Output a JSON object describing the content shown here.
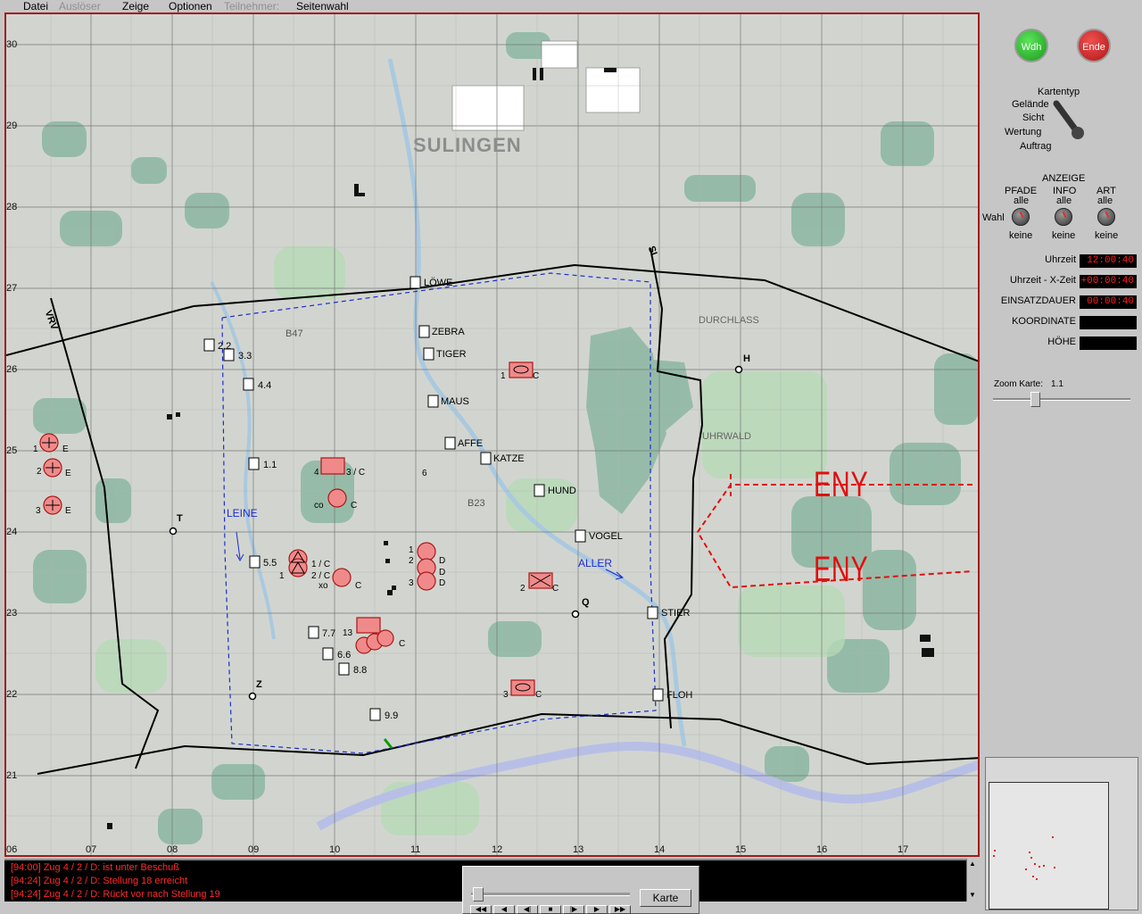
{
  "menu": {
    "items": [
      {
        "label": "Datei",
        "enabled": true
      },
      {
        "label": "Auslöser",
        "enabled": false
      },
      {
        "label": "Zeige",
        "enabled": true
      },
      {
        "label": "Optionen",
        "enabled": true
      },
      {
        "label": "Teilnehmer:",
        "enabled": false
      },
      {
        "label": "Seitenwahl",
        "enabled": true
      }
    ]
  },
  "map": {
    "grid_x_labels": [
      "06",
      "07",
      "08",
      "09",
      "10",
      "11",
      "12",
      "13",
      "14",
      "15",
      "16",
      "17"
    ],
    "grid_y_labels": [
      "30",
      "29",
      "28",
      "27",
      "26",
      "25",
      "24",
      "23",
      "22",
      "21"
    ],
    "city": "SULINGEN",
    "regions": [
      "DURCHLASS",
      "UHRWALD"
    ],
    "roads": [
      "B47",
      "B23"
    ],
    "rivers": [
      "LEINE",
      "ALLER"
    ],
    "boundary_labels": [
      "VRV",
      "SL"
    ],
    "positions": [
      "LÖWE",
      "ZEBRA",
      "TIGER",
      "MAUS",
      "AFFE",
      "KATZE",
      "HUND",
      "VOGEL",
      "STIER",
      "FLOH"
    ],
    "waypoints": [
      "2.2",
      "3.3",
      "4.4",
      "1.1",
      "5.5",
      "7.7",
      "6.6",
      "8.8",
      "9.9"
    ],
    "points": [
      "T",
      "Z",
      "Q",
      "H"
    ],
    "enemy_labels": [
      "ENY",
      "ENY"
    ],
    "unit_labels": {
      "e1": "1",
      "e1s": "E",
      "e2": "2",
      "e2s": "E",
      "e3": "3",
      "e3s": "E",
      "u4": "4",
      "u4b": "3 / C",
      "co": "co",
      "cos": "C",
      "u5": "1",
      "u5b": "1 / C",
      "u6": "2 / C",
      "xo": "xo",
      "xos": "C",
      "d1": "1",
      "d1s": "D",
      "d2": "2",
      "d2s": "D",
      "d3": "3",
      "d3s": "D",
      "num6": "6",
      "c1": "1",
      "c1s": "C",
      "c2": "2",
      "c2s": "C",
      "c3": "3",
      "c3s": "C",
      "u13": "13",
      "u13s": "C"
    },
    "colors": {
      "frame": "#a21a1a",
      "unit_fill": "#f08a8a",
      "unit_stroke": "#a81818",
      "enemy": "#e01010",
      "river": "#1a2ccf",
      "forest": "#8fb9a4"
    }
  },
  "panel": {
    "wdh_label": "Wdh",
    "ende_label": "Ende",
    "map_type": {
      "header": "Kartentyp",
      "options": [
        "Gelände",
        "Sicht",
        "Wertung",
        "Auftrag"
      ]
    },
    "anzeige_header": "ANZEIGE",
    "columns": [
      {
        "header": "PFADE",
        "top": "alle",
        "bottom": "keine"
      },
      {
        "header": "INFO",
        "top": "alle",
        "bottom": "keine"
      },
      {
        "header": "ART",
        "top": "alle",
        "bottom": "keine"
      }
    ],
    "wahl_label": "Wahl",
    "readouts": [
      {
        "label": "Uhrzeit",
        "value": "12:00:40"
      },
      {
        "label": "Uhrzeit - X-Zeit",
        "value": "+00:00:40"
      },
      {
        "label": "EINSATZDAUER",
        "value": "00:00:40"
      },
      {
        "label": "KOORDINATE",
        "value": ""
      },
      {
        "label": "HÖHE",
        "value": ""
      }
    ],
    "zoom_label": "Zoom Karte:",
    "zoom_value": "1.1"
  },
  "log": {
    "lines": [
      "[94:00] Zug 4 / 2 / D: ist unter Beschuß",
      "[94:24] Zug 4 / 2 / D: Stellung 18 erreicht",
      "[94:24] Zug 4 / 2 / D: Rückt vor nach Stellung 19"
    ]
  },
  "playback": {
    "karte_label": "Karte",
    "buttons": [
      "◀◀",
      "◀",
      "◀|",
      "■",
      "|▶",
      "▶",
      "▶▶"
    ]
  }
}
